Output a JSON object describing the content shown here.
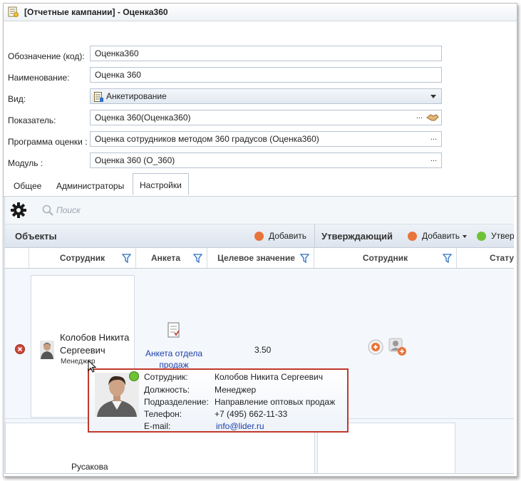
{
  "window": {
    "title": "[Отчетные кампании] - Оценка360"
  },
  "form": {
    "code_label": "Обозначение (код):",
    "code_value": "Оценка360",
    "name_label": "Наименование:",
    "name_value": "Оценка 360",
    "type_label": "Вид:",
    "type_value": "Анкетирование",
    "indicator_label": "Показатель:",
    "indicator_value": "Оценка 360(Оценка360)",
    "program_label": "Программа оценки :",
    "program_value": "Оценка сотрудников методом 360 градусов (Оценка360)",
    "module_label": "Модуль :",
    "module_value": "Оценка 360 (O_360)",
    "dots": "..."
  },
  "tabs": [
    {
      "label": "Общее"
    },
    {
      "label": "Администраторы"
    },
    {
      "label": "Настройки"
    }
  ],
  "toolbar": {
    "search_placeholder": "Поиск"
  },
  "objects": {
    "title": "Объекты",
    "add_label": "Добавить"
  },
  "approvers": {
    "title": "Утверждающий",
    "add_label": "Добавить",
    "approve_label": "Утвер"
  },
  "columns": {
    "employee": "Сотрудник",
    "survey": "Анкета",
    "target": "Целевое значение",
    "approver_employee": "Сотрудник",
    "status": "Стату"
  },
  "rows": [
    {
      "employee_name_line1": "Колобов Никита",
      "employee_name_line2": "Сергеевич",
      "position": "Менеджер",
      "survey_line1": "Анкета отдела",
      "survey_line2": "продаж",
      "target": "3.50"
    },
    {
      "employee_name_line1": "Русакова"
    }
  ],
  "tooltip": {
    "employee_label": "Сотрудник:",
    "employee_value": "Колобов Никита Сергеевич",
    "position_label": "Должность:",
    "position_value": "Менеджер",
    "department_label": "Подразделение:",
    "department_value": "Направление оптовых продаж",
    "phone_label": "Телефон:",
    "phone_value": "+7 (495) 662-11-33",
    "email_label": "E-mail:",
    "email_value": "info@lider.ru"
  },
  "colors": {
    "highlight_border": "#c0392b",
    "link": "#1d3fa8",
    "add_icon": "#e8743b",
    "approve_icon": "#6fc136",
    "status_online": "#6fc136"
  }
}
